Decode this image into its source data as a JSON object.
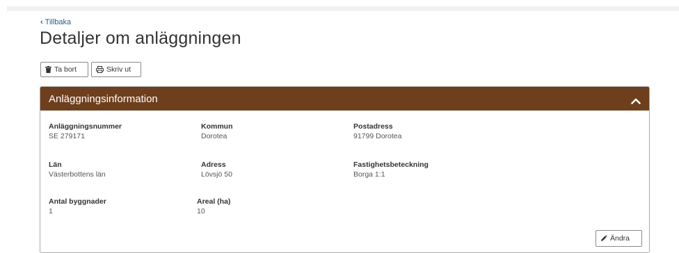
{
  "nav": {
    "back_label": "Tillbaka"
  },
  "page": {
    "title": "Detaljer om anläggningen"
  },
  "toolbar": {
    "delete_label": "Ta bort",
    "print_label": "Skriv ut"
  },
  "panel": {
    "title": "Anläggningsinformation",
    "fields": {
      "anlaggningsnummer": {
        "label": "Anläggningsnummer",
        "value": "SE 279171"
      },
      "kommun": {
        "label": "Kommun",
        "value": "Dorotea"
      },
      "postadress": {
        "label": "Postadress",
        "value": "91799 Dorotea"
      },
      "lan": {
        "label": "Län",
        "value": "Västerbottens län"
      },
      "adress": {
        "label": "Adress",
        "value": "Lövsjö 50"
      },
      "fastighetsbeteckning": {
        "label": "Fastighetsbeteckning",
        "value": "Borga 1:1"
      },
      "antal_byggnader": {
        "label": "Antal byggnader",
        "value": "1"
      },
      "areal": {
        "label": "Areal (ha)",
        "value": "10"
      }
    },
    "edit_label": "Ändra"
  },
  "colors": {
    "header_bg": "#6e3f1d",
    "link": "#2b5a8a"
  },
  "icons": [
    "chevron-left-icon",
    "trash-icon",
    "printer-icon",
    "chevron-up-icon",
    "pencil-icon"
  ]
}
